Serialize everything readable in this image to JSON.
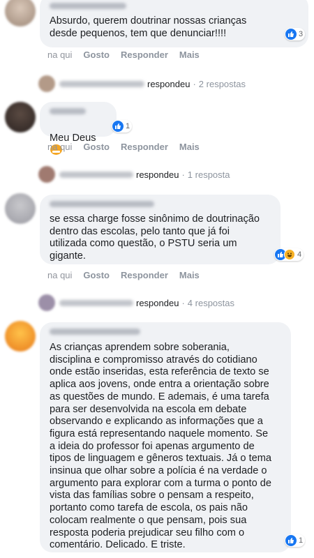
{
  "colors": {
    "bubble": "#f0f2f5",
    "like": "#1877f2",
    "meta": "#8d949e"
  },
  "actions": {
    "time": "na qui",
    "like": "Gosto",
    "reply": "Responder",
    "more": "Mais"
  },
  "comments": [
    {
      "text": "Absurdo, querem doutrinar nossas crianças\ndesde pequenos, tem que denunciar!!!!",
      "reaction_count": "3",
      "reply_summary": {
        "verb": "respondeu",
        "count": "2 respostas"
      }
    },
    {
      "text": "Meu Deus",
      "emoji": "angry-face-icon",
      "reaction_count": "1",
      "reply_summary": {
        "verb": "respondeu",
        "count": "1 resposta"
      }
    },
    {
      "text": "se essa charge fosse sinônimo de doutrinação\ndentro das escolas, pelo tanto que já foi\nutilizada como questão, o PSTU seria um\ngigante.",
      "reaction_count": "4",
      "reply_summary": {
        "verb": "respondeu",
        "count": "4 respostas"
      }
    },
    {
      "text": "As crianças aprendem sobre soberania,\ndisciplina e compromisso através do cotidiano\nonde estão inseridas, esta referência de texto se\naplica aos jovens, onde entra a orientação sobre\nas questões de mundo. E ademais, é uma tarefa\npara ser desenvolvida na escola em debate\nobservando e explicando as informações que a\nfigura está representando naquele momento. Se\na ideia do professor foi apenas argumento de\ntipos de linguagem e gêneros textuais. Já o tema\ninsinua que olhar sobre a polícia é na verdade o\nargumento para explorar com a turma o ponto de\nvista das famílias sobre o pensam a respeito,\nportanto como tarefa de escola, os pais não\ncolocam realmente o que pensam, pois sua\nresposta poderia prejudicar seu filho com o\ncomentário. Delicado. E triste.",
      "reaction_count": "1"
    }
  ]
}
